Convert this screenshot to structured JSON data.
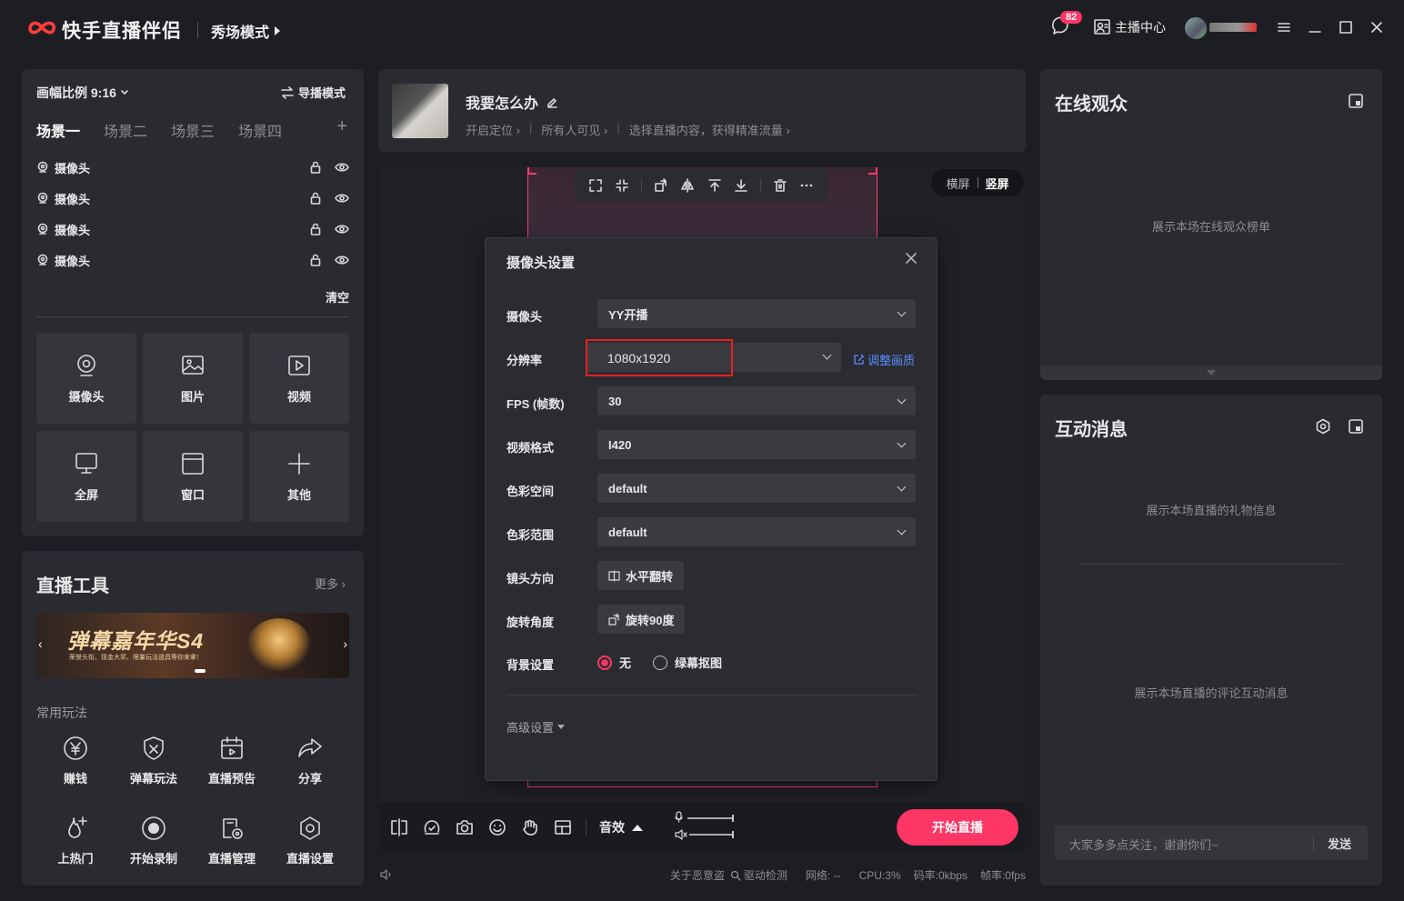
{
  "titlebar": {
    "app_name": "快手直播伴侣",
    "mode": "秀场模式",
    "message_badge": "82",
    "anchor_center": "主播中心"
  },
  "scene_panel": {
    "ratio": "画幅比例 9:16",
    "guide_mode": "导播模式",
    "scenes": [
      "场景一",
      "场景二",
      "场景三",
      "场景四"
    ],
    "sources": [
      "摄像头",
      "摄像头",
      "摄像头",
      "摄像头"
    ],
    "clear": "清空",
    "add_tiles": [
      {
        "label": "摄像头",
        "icon": "camera-icon"
      },
      {
        "label": "图片",
        "icon": "image-icon"
      },
      {
        "label": "视频",
        "icon": "video-icon"
      },
      {
        "label": "全屏",
        "icon": "monitor-icon"
      },
      {
        "label": "窗口",
        "icon": "window-icon"
      },
      {
        "label": "其他",
        "icon": "plus-icon"
      }
    ]
  },
  "tools_panel": {
    "title": "直播工具",
    "more": "更多",
    "banner_title": "弹幕嘉年华S4",
    "banner_sub": "荣誉头衔、现金大奖、限量玩法道具等你来拿！",
    "common_label": "常用玩法",
    "tools": [
      {
        "label": "赚钱",
        "icon": "yuan-icon"
      },
      {
        "label": "弹幕玩法",
        "icon": "danmu-icon"
      },
      {
        "label": "直播预告",
        "icon": "calendar-icon"
      },
      {
        "label": "分享",
        "icon": "share-icon"
      },
      {
        "label": "上热门",
        "icon": "fire-icon"
      },
      {
        "label": "开始录制",
        "icon": "record-icon"
      },
      {
        "label": "直播管理",
        "icon": "manage-icon"
      },
      {
        "label": "直播设置",
        "icon": "settings-icon"
      }
    ]
  },
  "room": {
    "title": "我要怎么办",
    "location": "开启定位",
    "visibility": "所有人可见",
    "content_hint": "选择直播内容，获得精准流量"
  },
  "stage": {
    "landscape": "横屏",
    "portrait": "竖屏"
  },
  "camera_dialog": {
    "title": "摄像头设置",
    "labels": {
      "camera": "摄像头",
      "resolution": "分辨率",
      "fps": "FPS (帧数)",
      "video_format": "视频格式",
      "color_space": "色彩空间",
      "color_range": "色彩范围",
      "lens": "镜头方向",
      "rotation": "旋转角度",
      "background": "背景设置"
    },
    "values": {
      "camera": "YY开播",
      "resolution": "1080x1920",
      "fps": "30",
      "video_format": "I420",
      "color_space": "default",
      "color_range": "default"
    },
    "adjust_quality": "调整画质",
    "flip_button": "水平翻转",
    "rotate_button": "旋转90度",
    "bg_options": [
      "无",
      "绿幕抠图"
    ],
    "bg_selected": "无",
    "advanced": "高级设置"
  },
  "bottom_bar": {
    "effect": "音效",
    "start": "开始直播"
  },
  "status_bar": {
    "about": "关于恶意盗",
    "driver": "驱动检测",
    "network": "网络: --",
    "cpu": "CPU:3%",
    "bitrate": "码率:0kbps",
    "framerate": "帧率:0fps"
  },
  "audience_panel": {
    "title": "在线观众",
    "empty": "展示本场在线观众榜单"
  },
  "interaction_panel": {
    "title": "互动消息",
    "gift_empty": "展示本场直播的礼物信息",
    "comment_empty": "展示本场直播的评论互动消息",
    "chat_placeholder": "大家多多点关注，谢谢你们~",
    "send": "发送"
  },
  "colors": {
    "accent": "#fe3666",
    "highlight_box": "#e8201f",
    "link": "#5a8cff"
  }
}
